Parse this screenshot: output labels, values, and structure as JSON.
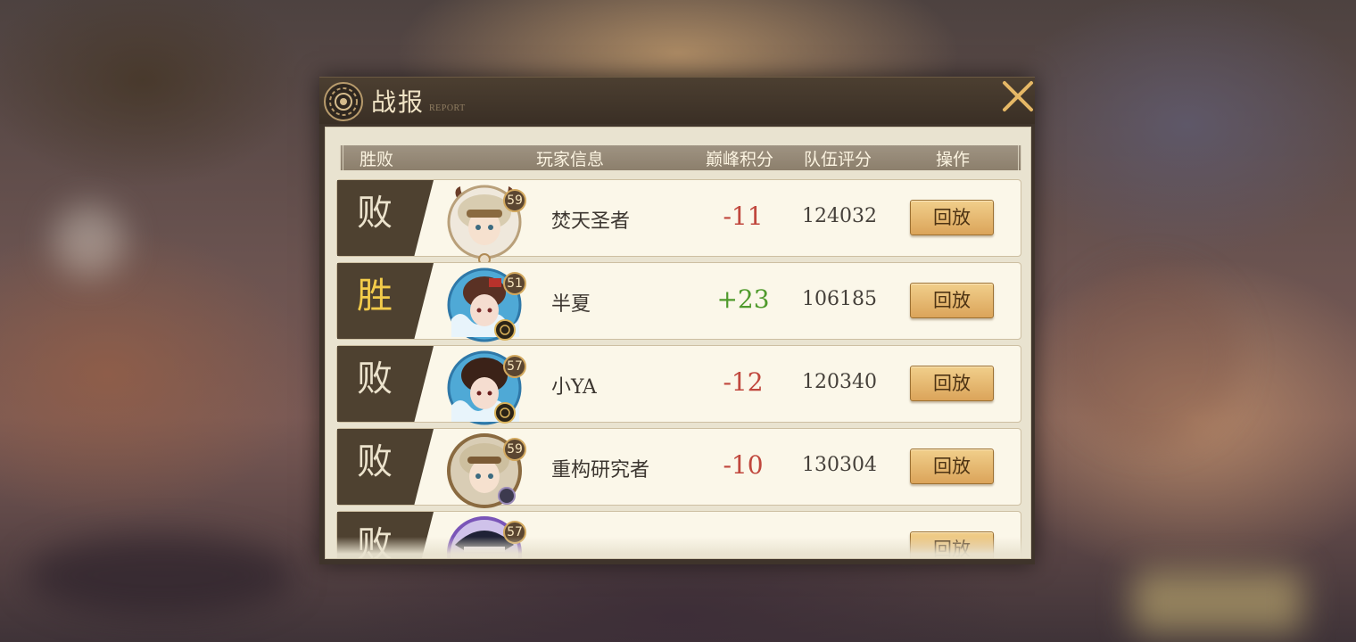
{
  "panel": {
    "title": "战报",
    "subtitle": "REPORT"
  },
  "columns": {
    "result": "胜败",
    "player": "玩家信息",
    "peak_points": "巅峰积分",
    "team_rating": "队伍评分",
    "action": "操作"
  },
  "rows": [
    {
      "result": "败",
      "level": "59",
      "name": "焚天圣者",
      "points": "-11",
      "team_rating": "124032",
      "replay": "回放"
    },
    {
      "result": "胜",
      "level": "51",
      "name": "半夏",
      "points": "+23",
      "team_rating": "106185",
      "replay": "回放"
    },
    {
      "result": "败",
      "level": "57",
      "name": "小YA",
      "points": "-12",
      "team_rating": "120340",
      "replay": "回放"
    },
    {
      "result": "败",
      "level": "59",
      "name": "重构研究者",
      "points": "-10",
      "team_rating": "130304",
      "replay": "回放"
    },
    {
      "result": "败",
      "level": "57",
      "name": "",
      "points": "",
      "team_rating": "",
      "replay": "回放"
    }
  ],
  "colors": {
    "win": "#f3cc4a",
    "loss_points": "#c0473d",
    "win_points": "#4f9a2c",
    "button": "#dba45a"
  },
  "icons": {
    "header_emblem": "gear-emblem-icon",
    "close": "close-icon"
  }
}
